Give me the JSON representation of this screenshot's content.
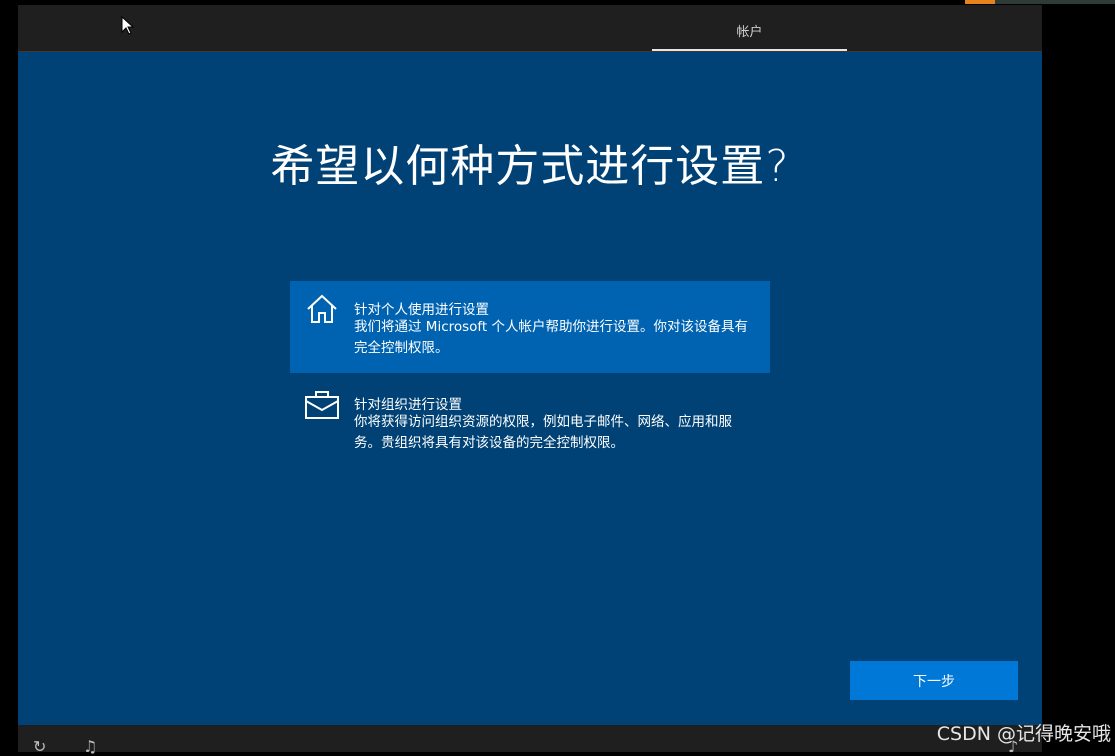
{
  "header": {
    "tab_label": "帐户"
  },
  "main": {
    "title": "希望以何种方式进行设置?",
    "options": [
      {
        "title": "针对个人使用进行设置",
        "description": "我们将通过 Microsoft 个人帐户帮助你进行设置。你对该设备具有完全控制权限。",
        "icon": "home-icon",
        "selected": true
      },
      {
        "title": "针对组织进行设置",
        "description": "你将获得访问组织资源的权限，例如电子邮件、网络、应用和服务。贵组织将具有对该设备的完全控制权限。",
        "icon": "briefcase-icon",
        "selected": false
      }
    ],
    "next_label": "下一步"
  },
  "footer": {
    "accessibility_icon": "accessibility-icon",
    "microphone_icon": "microphone-icon",
    "volume_icon": "volume-icon"
  },
  "watermark": "CSDN @记得晚安哦",
  "colors": {
    "background": "#004275",
    "selected_option": "#0063b1",
    "next_button": "#0078d7",
    "topbar": "#1f1f1f",
    "accent": "#e8821c"
  }
}
